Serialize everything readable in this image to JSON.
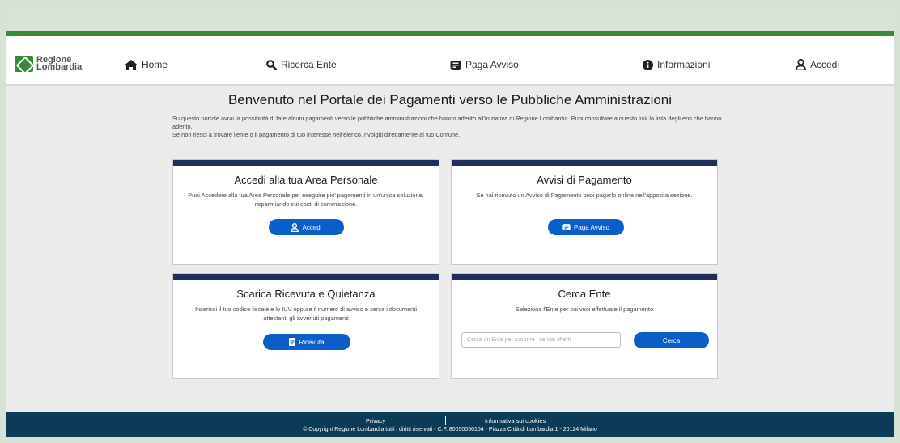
{
  "brand": {
    "line1": "Regione",
    "line2": "Lombardia"
  },
  "nav": {
    "home": "Home",
    "ricerca": "Ricerca Ente",
    "paga": "Paga Avviso",
    "info": "Informazioni",
    "accedi": "Accedi"
  },
  "main": {
    "title": "Benvenuto nel Portale dei Pagamenti verso le Pubbliche Amministrazioni",
    "intro_1": "Su questo portale avrai la possibilità di fare alcuni pagamenti verso le pubbliche amministrazioni che hanno aderito all'iniziativa di Regione Lombardia. Puoi consultare a questo ",
    "intro_link": "link",
    "intro_2": " la lista degli enti che hanno aderito.",
    "intro_3": "Se non riesci a trovare l'ente o il pagamento di tuo interesse nell'elenco, rivolgiti direttamente al tuo Comune."
  },
  "cards": {
    "area": {
      "title": "Accedi alla tua Area Personale",
      "text": "Puoi Accedere alla tua Area Personale per eseguire piu' pagamenti in un'unica soluzione, risparmiando sui costi di commissione.",
      "button": "Accedi"
    },
    "avvisi": {
      "title": "Avvisi di Pagamento",
      "text": "Se hai ricevuto un Avviso di Pagamento puoi pagarlo online nell'apposita sezione.",
      "button": "Paga Avviso"
    },
    "ricevuta": {
      "title": "Scarica Ricevuta e Quietanza",
      "text": "Inserisci il tuo codice fiscale e lo IUV oppure il numero di avviso e cerca i documenti attestanti gli avvenuti pagamenti",
      "button": "Ricevuta"
    },
    "cerca": {
      "title": "Cerca Ente",
      "text": "Seleziona l'Ente per cui vuoi effettuare il pagamento",
      "placeholder": "Cerca un Ente per scoprire i servizi offerti",
      "button": "Cerca"
    }
  },
  "footer": {
    "privacy": "Privacy",
    "cookies": "Informativa sui cookies",
    "copyright": "© Copyright Regione Lombardia tutti i diritti riservati - C.F. 80050050154 - Piazza Città di Lombardia 1 - 20124 Milano"
  },
  "colors": {
    "accent": "#0a5ec8",
    "brand_green": "#3a8a3c",
    "card_bar": "#1f2f5a",
    "footer": "#0c3b58"
  }
}
